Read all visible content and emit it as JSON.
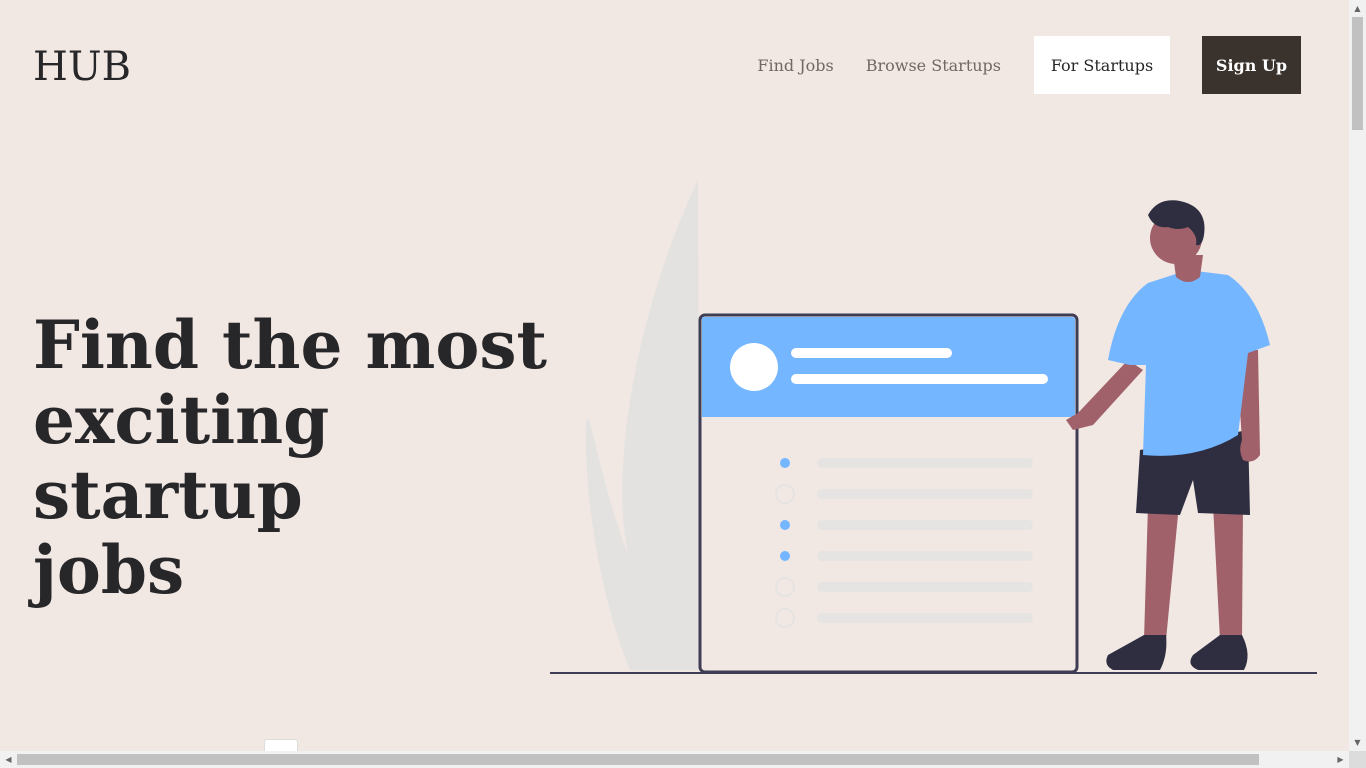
{
  "brand": {
    "logo": "HUB"
  },
  "nav": {
    "find_jobs": "Find Jobs",
    "browse_startups": "Browse Startups",
    "for_startups": "For Startups",
    "sign_up": "Sign Up"
  },
  "hero": {
    "title_line1": "Find the most",
    "title_line2": "exciting startup",
    "title_line3": "jobs"
  },
  "colors": {
    "background": "#f1e7e3",
    "accent_blue": "#74b6ff",
    "dark": "#2f2e41",
    "skin": "#a0616a",
    "button_dark": "#3a322d"
  },
  "icons": {
    "scroll_up": "▲",
    "scroll_down": "▼",
    "scroll_left": "◀",
    "scroll_right": "▶"
  }
}
